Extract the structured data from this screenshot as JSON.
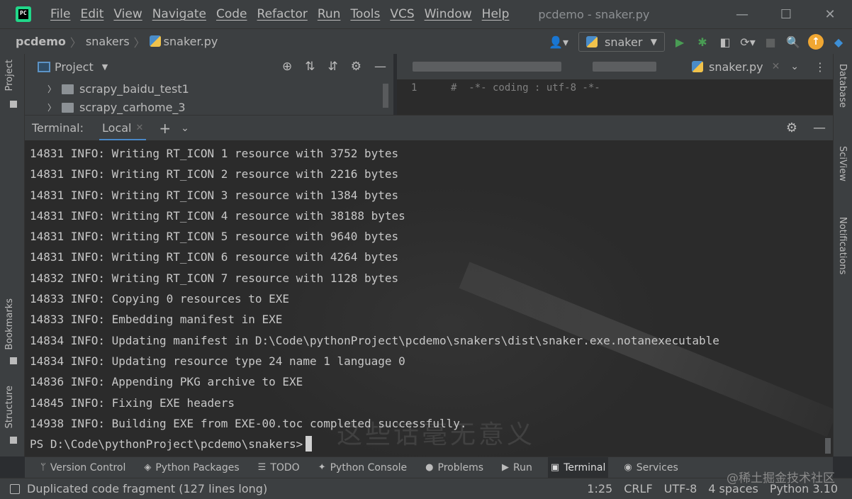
{
  "titlebar": {
    "menu": [
      "File",
      "Edit",
      "View",
      "Navigate",
      "Code",
      "Refactor",
      "Run",
      "Tools",
      "VCS",
      "Window",
      "Help"
    ],
    "window_title": "pcdemo - snaker.py",
    "minimize": "—",
    "maximize": "☐",
    "close": "✕"
  },
  "navbar": {
    "project": "pcdemo",
    "folder": "snakers",
    "file": "snaker.py",
    "run_config": "snaker"
  },
  "project_panel": {
    "title": "Project",
    "tree": [
      "scrapy_baidu_test1",
      "scrapy_carhome_3"
    ]
  },
  "editor": {
    "active_tab": "snaker.py",
    "line_number": "1",
    "first_line": "#  -*- coding : utf-8 -*-"
  },
  "left_strip": {
    "project": "Project",
    "bookmarks": "Bookmarks",
    "structure": "Structure"
  },
  "right_strip": {
    "database": "Database",
    "sciview": "SciView",
    "notifications": "Notifications"
  },
  "terminal": {
    "title": "Terminal:",
    "tab": "Local",
    "lines": [
      "14831 INFO: Writing RT_ICON 1 resource with 3752 bytes",
      "14831 INFO: Writing RT_ICON 2 resource with 2216 bytes",
      "14831 INFO: Writing RT_ICON 3 resource with 1384 bytes",
      "14831 INFO: Writing RT_ICON 4 resource with 38188 bytes",
      "14831 INFO: Writing RT_ICON 5 resource with 9640 bytes",
      "14831 INFO: Writing RT_ICON 6 resource with 4264 bytes",
      "14832 INFO: Writing RT_ICON 7 resource with 1128 bytes",
      "14833 INFO: Copying 0 resources to EXE",
      "14833 INFO: Embedding manifest in EXE",
      "14834 INFO: Updating manifest in D:\\Code\\pythonProject\\pcdemo\\snakers\\dist\\snaker.exe.notanexecutable",
      "14834 INFO: Updating resource type 24 name 1 language 0",
      "14836 INFO: Appending PKG archive to EXE",
      "14845 INFO: Fixing EXE headers",
      "14938 INFO: Building EXE from EXE-00.toc completed successfully."
    ],
    "prompt": "PS D:\\Code\\pythonProject\\pcdemo\\snakers>",
    "background_text": "这些话毫无意义"
  },
  "tool_tabs": [
    {
      "icon": "version-control-icon",
      "glyph": "ᛘ",
      "label": "Version Control"
    },
    {
      "icon": "python-packages-icon",
      "glyph": "◈",
      "label": "Python Packages"
    },
    {
      "icon": "todo-icon",
      "glyph": "☰",
      "label": "TODO"
    },
    {
      "icon": "python-console-icon",
      "glyph": "✦",
      "label": "Python Console"
    },
    {
      "icon": "problems-icon",
      "glyph": "●",
      "label": "Problems"
    },
    {
      "icon": "run-icon",
      "glyph": "▶",
      "label": "Run"
    },
    {
      "icon": "terminal-icon",
      "glyph": "▣",
      "label": "Terminal"
    },
    {
      "icon": "services-icon",
      "glyph": "◉",
      "label": "Services"
    }
  ],
  "statusbar": {
    "message": "Duplicated code fragment (127 lines long)",
    "position": "1:25",
    "line_sep": "CRLF",
    "encoding": "UTF-8",
    "indent": "4 spaces",
    "interpreter": "Python 3.10"
  },
  "watermark": "@稀土掘金技术社区"
}
